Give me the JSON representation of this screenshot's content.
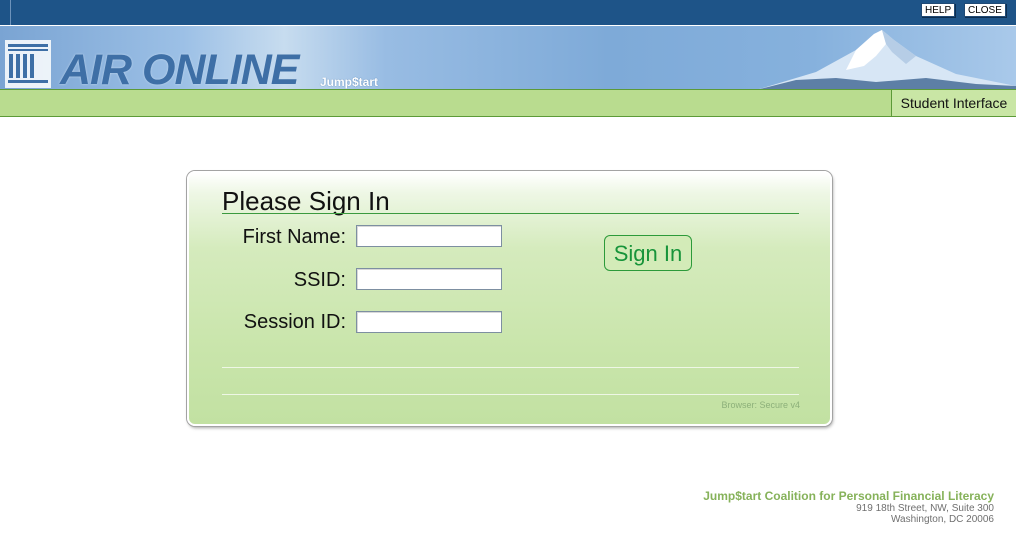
{
  "header": {
    "help_label": "HELP",
    "close_label": "CLOSE",
    "brand_name": "AIR ONLINE",
    "brand_subtitle": "Jump$tart",
    "interface_label": "Student Interface"
  },
  "signin": {
    "title": "Please Sign In",
    "fields": [
      {
        "label": "First Name:",
        "value": ""
      },
      {
        "label": "SSID:",
        "value": ""
      },
      {
        "label": "Session ID:",
        "value": ""
      }
    ],
    "button_label": "Sign In",
    "browser_note": "Browser: Secure v4"
  },
  "footer": {
    "org_name": "Jump$tart Coalition for Personal Financial Literacy",
    "address_line1": "919 18th Street, NW, Suite 300",
    "address_line2": "Washington, DC 20006"
  },
  "colors": {
    "topbar": "#1e5488",
    "banner_blue": "#7eaad8",
    "green_strip": "#b9dc8f",
    "panel_green": "#c9e5ab",
    "signin_text": "#17943a",
    "footer_org": "#86b25a"
  },
  "icons": {
    "logo": "building-columns-icon",
    "banner_image": "mountain-icon"
  }
}
